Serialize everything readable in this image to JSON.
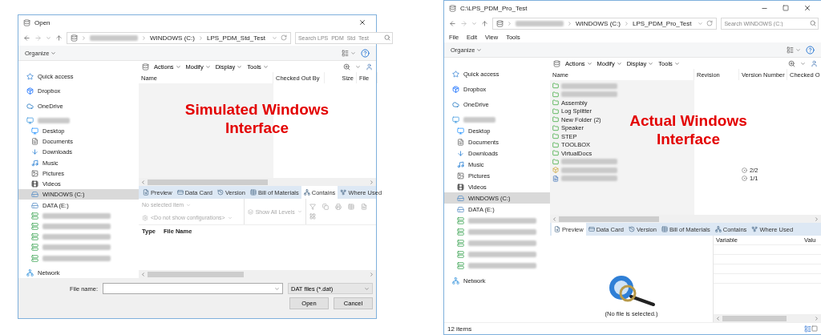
{
  "windows": [
    {
      "kind": "dialog",
      "title": "Open",
      "path": [
        "WINDOWS (C:)",
        "LPS_PDM_Std_Test"
      ],
      "search": {
        "placeholder": "Search LPS_PDM_Std_Test"
      },
      "organize": "Organize",
      "sidebar": [
        {
          "kind": "quick",
          "label": "Quick access",
          "selected": false
        },
        {
          "kind": "dropbox",
          "label": "Dropbox",
          "selected": false
        },
        {
          "kind": "cloud",
          "label": "OneDrive",
          "selected": false
        },
        {
          "kind": "pc",
          "selected": false
        },
        {
          "kind": "desktop",
          "label": "Desktop",
          "selected": false
        },
        {
          "kind": "documents",
          "label": "Documents",
          "selected": false
        },
        {
          "kind": "downloads",
          "label": "Downloads",
          "selected": false
        },
        {
          "kind": "music",
          "label": "Music",
          "selected": false
        },
        {
          "kind": "pictures",
          "label": "Pictures",
          "selected": false
        },
        {
          "kind": "videos",
          "label": "Videos",
          "selected": false
        },
        {
          "kind": "drive",
          "label": "WINDOWS (C:)",
          "selected": true
        },
        {
          "kind": "drive",
          "label": "DATA (E:)",
          "selected": false
        },
        {
          "kind": "netdrive",
          "selected": false
        },
        {
          "kind": "netdrive",
          "selected": false
        },
        {
          "kind": "netdrive",
          "selected": false
        },
        {
          "kind": "netdrive",
          "selected": false
        },
        {
          "kind": "netdrive",
          "selected": false
        },
        {
          "kind": "network",
          "label": "Network",
          "selected": false
        }
      ],
      "pdm_menu": [
        "Actions",
        "Modify",
        "Display",
        "Tools"
      ],
      "columns": [
        "Name",
        "Checked Out By",
        "Size",
        "File"
      ],
      "caption": "Simulated Windows Interface",
      "tabs": [
        {
          "label": "Preview",
          "selected": false
        },
        {
          "label": "Data Card",
          "selected": false
        },
        {
          "label": "Version",
          "selected": false
        },
        {
          "label": "Bill of Materials",
          "selected": false
        },
        {
          "label": "Contains",
          "selected": true
        },
        {
          "label": "Where Used",
          "selected": false
        }
      ],
      "contains": {
        "item": "No selected item",
        "configurations": "<Do not show configurations>",
        "levels": "Show All Levels",
        "columns": [
          "Type",
          "File Name"
        ]
      },
      "footer": {
        "label": "File name:",
        "filter": "DAT files (*.dat)",
        "buttons": [
          "Open",
          "Cancel"
        ]
      }
    },
    {
      "kind": "explorer",
      "title": "C:\\LPS_PDM_Pro_Test",
      "path": [
        "WINDOWS (C:)",
        "LPS_PDM_Pro_Test"
      ],
      "search": {
        "placeholder": "Search WINDOWS (C:)"
      },
      "menu": [
        "File",
        "Edit",
        "View",
        "Tools"
      ],
      "organize": "Organize",
      "sidebar": [
        {
          "kind": "quick",
          "label": "Quick access",
          "selected": false
        },
        {
          "kind": "dropbox",
          "label": "Dropbox",
          "selected": false
        },
        {
          "kind": "cloud",
          "label": "OneDrive",
          "selected": false
        },
        {
          "kind": "pc",
          "selected": false
        },
        {
          "kind": "desktop",
          "label": "Desktop",
          "selected": false
        },
        {
          "kind": "documents",
          "label": "Documents",
          "selected": false
        },
        {
          "kind": "downloads",
          "label": "Downloads",
          "selected": false
        },
        {
          "kind": "music",
          "label": "Music",
          "selected": false
        },
        {
          "kind": "pictures",
          "label": "Pictures",
          "selected": false
        },
        {
          "kind": "videos",
          "label": "Videos",
          "selected": false
        },
        {
          "kind": "drive",
          "label": "WINDOWS (C:)",
          "selected": true
        },
        {
          "kind": "drive",
          "label": "DATA (E:)",
          "selected": false
        },
        {
          "kind": "netdrive",
          "selected": false
        },
        {
          "kind": "netdrive",
          "selected": false
        },
        {
          "kind": "netdrive",
          "selected": false
        },
        {
          "kind": "netdrive",
          "selected": false
        },
        {
          "kind": "netdrive",
          "selected": false
        },
        {
          "kind": "network",
          "label": "Network",
          "selected": false
        }
      ],
      "pdm_menu": [
        "Actions",
        "Modify",
        "Display",
        "Tools"
      ],
      "columns": [
        "Name",
        "Revision",
        "Version Number",
        "Checked O"
      ],
      "files": [
        {
          "kind": "folder"
        },
        {
          "kind": "folder"
        },
        {
          "kind": "folder",
          "name": "Assembly"
        },
        {
          "kind": "folder",
          "name": "Log Splitter"
        },
        {
          "kind": "folder",
          "name": "New Folder (2)"
        },
        {
          "kind": "folder",
          "name": "Speaker"
        },
        {
          "kind": "folder",
          "name": "STEP"
        },
        {
          "kind": "folder",
          "name": "TOOLBOX"
        },
        {
          "kind": "folder",
          "name": "VirtualDocs"
        },
        {
          "kind": "folder"
        },
        {
          "kind": "part",
          "version": "2/2"
        },
        {
          "kind": "doc",
          "version": "1/1"
        }
      ],
      "caption": "Actual Windows Interface",
      "tabs": [
        {
          "label": "Preview",
          "selected": true
        },
        {
          "label": "Data Card",
          "selected": false
        },
        {
          "label": "Version",
          "selected": false
        },
        {
          "label": "Bill of Materials",
          "selected": false
        },
        {
          "label": "Contains",
          "selected": false
        },
        {
          "label": "Where Used",
          "selected": false
        }
      ],
      "preview": {
        "message": "(No file is selected.)",
        "columns": [
          "Variable",
          "Valu"
        ]
      },
      "status": "12 items"
    }
  ]
}
